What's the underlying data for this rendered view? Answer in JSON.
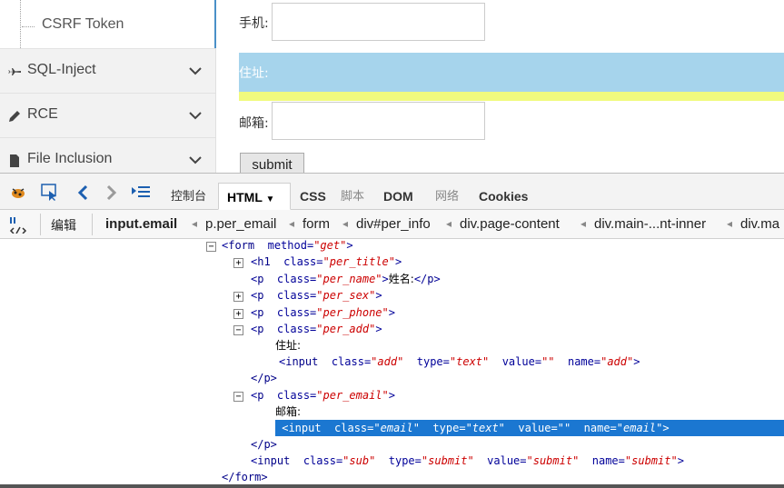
{
  "sidebar": {
    "sub_item": "CSRF Token",
    "items": [
      {
        "label": "SQL-Inject",
        "icon": "plane-icon"
      },
      {
        "label": "RCE",
        "icon": "pencil-icon"
      },
      {
        "label": "File Inclusion",
        "icon": "file-icon"
      }
    ]
  },
  "form": {
    "phone_label": "手机:",
    "address_label": "住址:",
    "email_label": "邮箱:",
    "submit_label": "submit"
  },
  "devtools": {
    "tabs": [
      "控制台",
      "HTML",
      "CSS",
      "脚本",
      "DOM",
      "网络",
      "Cookies"
    ],
    "edit_label": "编辑",
    "breadcrumbs": [
      "input.email",
      "p.per_email",
      "form",
      "div#per_info",
      "div.page-content",
      "div.main-...nt-inner",
      "div.ma"
    ],
    "tree": {
      "form_open_tag": "form",
      "form_attr": "method",
      "form_attr_val": "\"get\"",
      "h1_tag": "h1",
      "class_attr": "class",
      "h1_class": "\"per_title\"",
      "p_tag": "p",
      "per_name_class": "\"per_name\"",
      "name_text": "姓名:",
      "per_sex_class": "\"per_sex\"",
      "per_phone_class": "\"per_phone\"",
      "per_add_class": "\"per_add\"",
      "address_text": "住址:",
      "input_tag": "input",
      "type_attr": "type",
      "value_attr": "value",
      "name_attr": "name",
      "add_class": "\"add\"",
      "text_val": "\"text\"",
      "empty_val": "\"\"",
      "add_name": "\"add\"",
      "p_close": "</p>",
      "per_email_class": "\"per_email\"",
      "email_text": "邮箱:",
      "email_class": "\"email\"",
      "email_name": "\"email\"",
      "sub_class": "\"sub\"",
      "submit_type": "\"submit\"",
      "submit_value": "\"submit\"",
      "submit_name": "\"submit\"",
      "form_close": "</form>"
    }
  },
  "colors": {
    "highlight_blue": "#a6d4ec",
    "highlight_yellow": "#f0fa7e",
    "selected_row": "#1b77d1"
  }
}
